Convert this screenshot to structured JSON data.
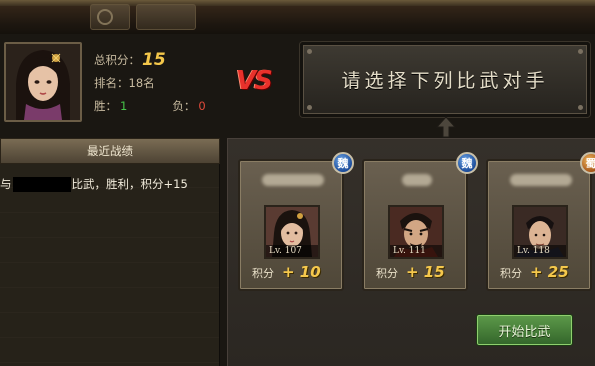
{
  "player": {
    "total_points_label": "总积分：",
    "total_points_value": "15",
    "rank_text": "排名：18名",
    "wins_label": "胜：",
    "wins_value": "1",
    "losses_label": "负：",
    "losses_value": "0"
  },
  "vs_text": "VS",
  "prompt_text": "请选择下列比武对手",
  "recent": {
    "header": "最近战绩",
    "entry_prefix": "与",
    "entry_suffix": "比武，胜利，积分+15"
  },
  "opponents": [
    {
      "level": "Lv. 107",
      "points_label": "积分",
      "points_value": "+ 10",
      "faction": "魏"
    },
    {
      "level": "Lv. 111",
      "points_label": "积分",
      "points_value": "+ 15",
      "faction": "魏"
    },
    {
      "level": "Lv. 118",
      "points_label": "积分",
      "points_value": "+ 25",
      "faction": "蜀"
    }
  ],
  "start_button": "开始比武",
  "colors": {
    "accent_gold": "#f4c74a",
    "win_green": "#46c44a",
    "loss_red": "#e04a3a",
    "vs_red": "#e8312b",
    "button_green": "#4a8a3a"
  }
}
